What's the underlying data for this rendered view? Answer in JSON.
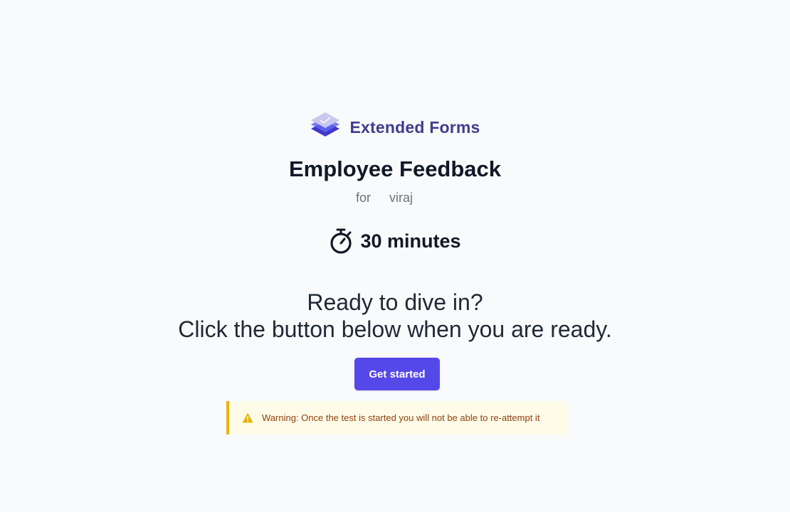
{
  "brand": {
    "name": "Extended Forms",
    "logo_icon": "stacked-form-logo"
  },
  "form": {
    "title": "Employee Feedback",
    "for_label": "for",
    "recipient": "viraj"
  },
  "duration": {
    "icon": "stopwatch-icon",
    "text": "30 minutes"
  },
  "prompt": {
    "line1": "Ready to dive in?",
    "line2": "Click the button below when you are ready."
  },
  "actions": {
    "start_label": "Get started"
  },
  "warning": {
    "icon": "warning-triangle-icon",
    "text": "Warning: Once the test is started you will not be able to re-attempt it"
  },
  "colors": {
    "background": "#f9fafb",
    "primary": "#5548e8",
    "brand_text": "#3f3d8f",
    "warning_bg": "#fefce8",
    "warning_border": "#eab308",
    "warning_text": "#92400e"
  }
}
